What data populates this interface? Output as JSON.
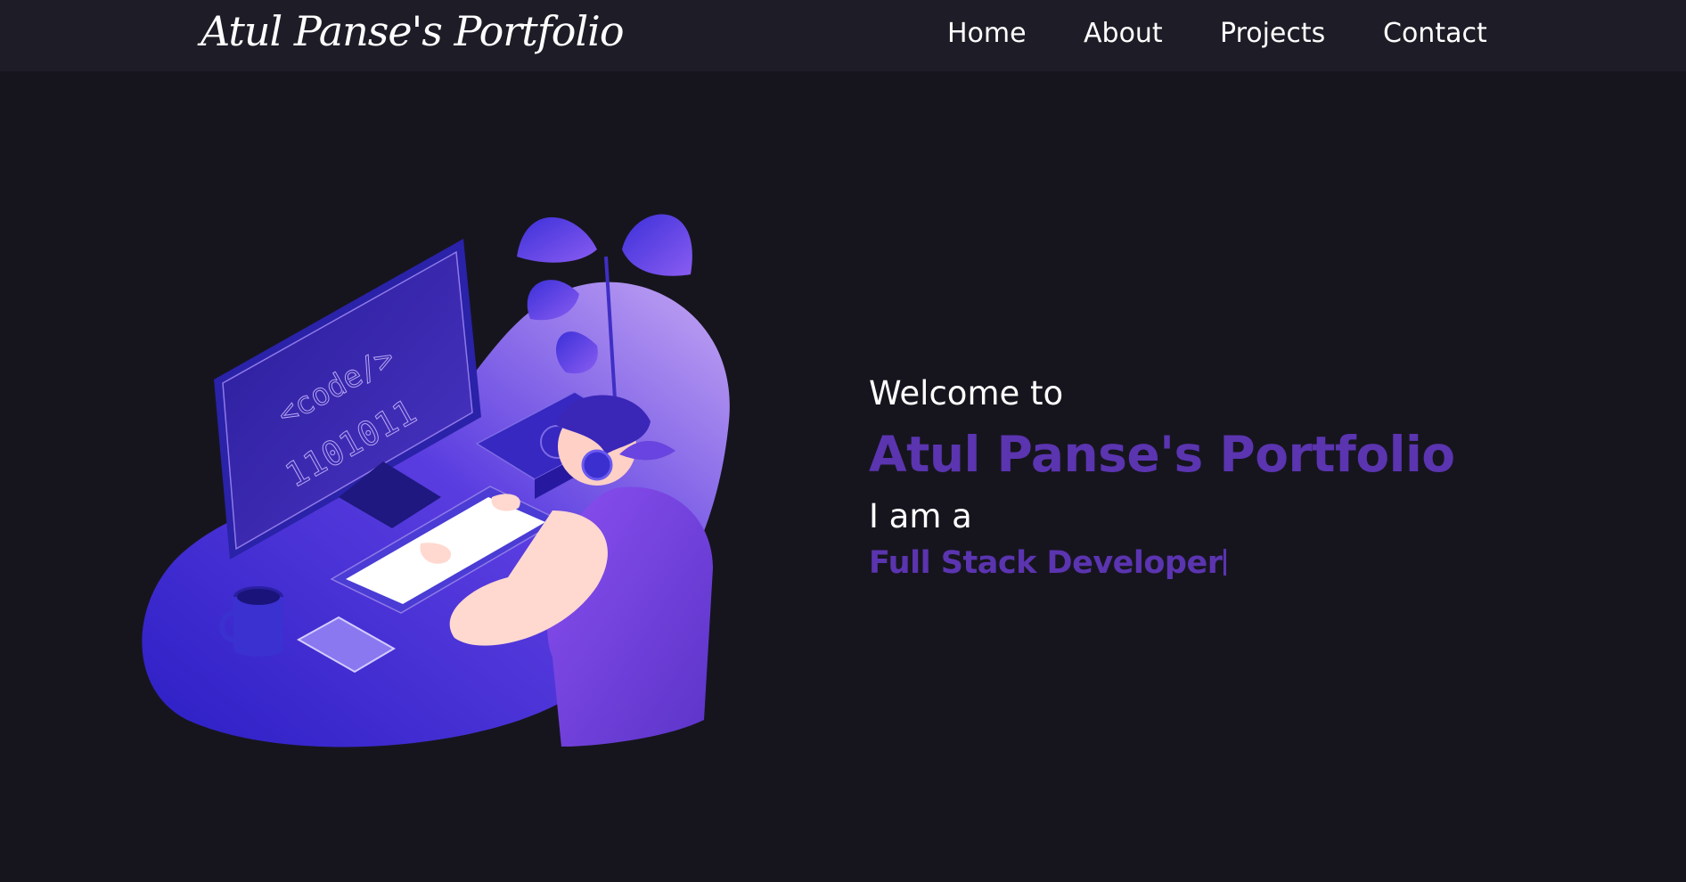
{
  "navbar": {
    "brand": "Atul Panse's Portfolio",
    "links": [
      {
        "label": "Home"
      },
      {
        "label": "About"
      },
      {
        "label": "Projects"
      },
      {
        "label": "Contact"
      }
    ]
  },
  "hero": {
    "welcome": "Welcome to",
    "title": "Atul Panse's Portfolio",
    "intro": "I am a",
    "typed_role": "Full Stack Developer",
    "illustration": {
      "monitor_text_1": "<code/>",
      "monitor_text_2": "1101011"
    }
  },
  "colors": {
    "background": "#16151e",
    "navbar": "#1e1d27",
    "accent": "#5b34b0",
    "text": "#ffffff"
  }
}
